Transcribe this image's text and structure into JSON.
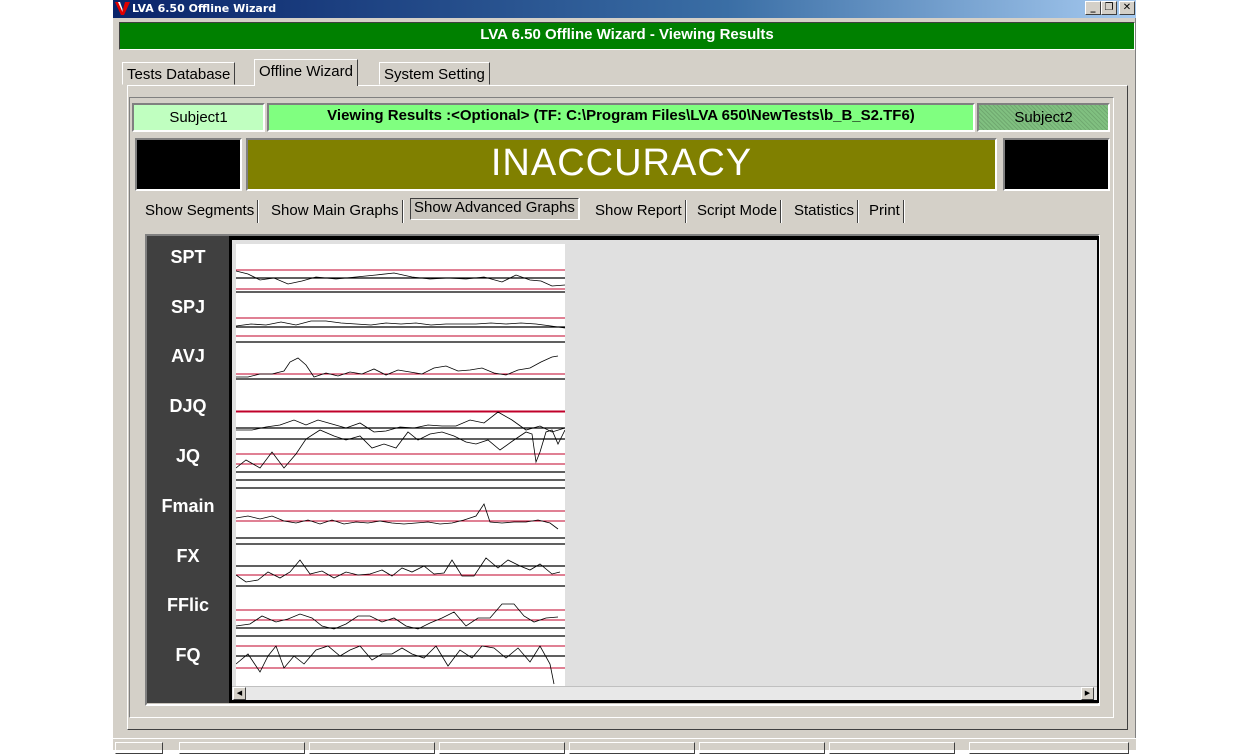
{
  "window": {
    "title": "LVA 6.50 Offline Wizard",
    "controls": {
      "minimize": "_",
      "restore": "❐",
      "close": "✕"
    }
  },
  "banner": {
    "text": "LVA 6.50 Offline Wizard - Viewing Results"
  },
  "top_tabs": [
    {
      "label": "Tests Database",
      "active": false
    },
    {
      "label": "Offline Wizard",
      "active": true
    },
    {
      "label": "System Setting",
      "active": false
    }
  ],
  "subject1": {
    "label": "Subject1"
  },
  "viewing": {
    "text": "Viewing Results :<Optional>  (TF: C:\\Program Files\\LVA 650\\NewTests\\b_B_S2.TF6)"
  },
  "subject2": {
    "label": "Subject2"
  },
  "result": {
    "text": "INACCURACY"
  },
  "sub_tabs": [
    {
      "label": "Show Segments",
      "active": false
    },
    {
      "label": "Show Main Graphs",
      "active": false
    },
    {
      "label": "Show Advanced Graphs",
      "active": true
    },
    {
      "label": "Show Report",
      "active": false
    },
    {
      "label": "Script Mode",
      "active": false
    },
    {
      "label": "Statistics",
      "active": false
    },
    {
      "label": "Print",
      "active": false
    }
  ],
  "graph_labels": [
    "SPT",
    "SPJ",
    "AVJ",
    "DJQ",
    "JQ",
    "Fmain",
    "FX",
    "FFlic",
    "FQ"
  ],
  "scroll": {
    "left_arrow": "◀",
    "right_arrow": "▶"
  },
  "colors": {
    "banner_green": "#008000",
    "result_olive": "#808000",
    "subject1_bg": "#c0ffc0",
    "viewing_bg": "#80ff80",
    "threshold_line": "#c0002a",
    "trace": "#000000"
  }
}
